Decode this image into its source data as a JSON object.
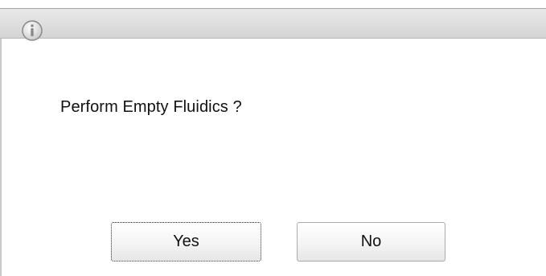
{
  "dialog": {
    "icon": "info-icon",
    "message": "Perform Empty Fluidics ?",
    "buttons": {
      "yes_label": "Yes",
      "no_label": "No"
    }
  },
  "colors": {
    "titlebar": "#d9d9d9",
    "background": "#ffffff",
    "text": "#111111"
  }
}
